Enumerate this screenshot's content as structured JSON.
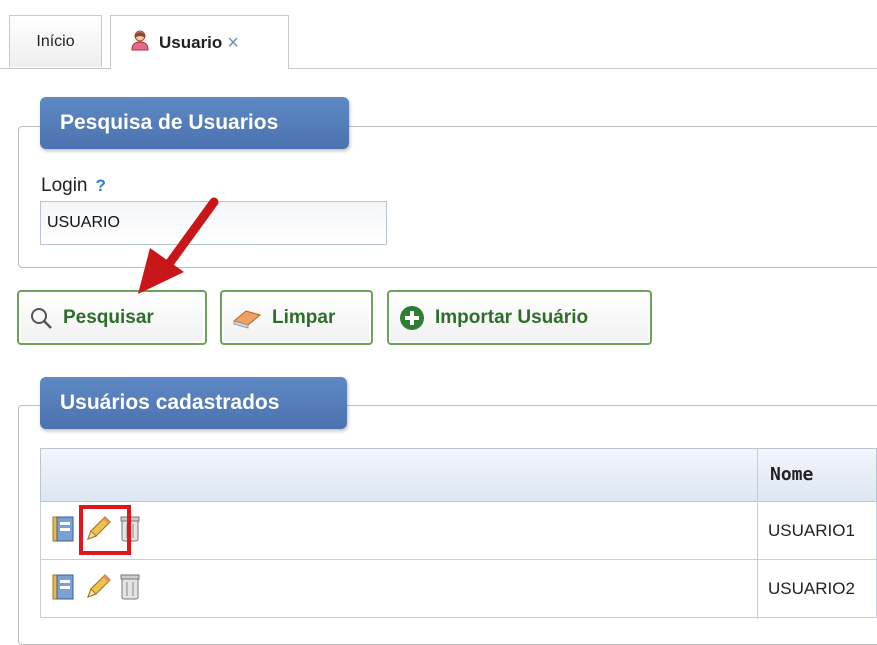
{
  "tabs": [
    {
      "label": "Início",
      "active": false
    },
    {
      "label": "Usuario",
      "active": true,
      "icon": "user-icon"
    }
  ],
  "search_panel": {
    "title": "Pesquisa de Usuarios",
    "login_label": "Login",
    "help_glyph": "?",
    "login_value": "USUARIO"
  },
  "buttons": {
    "pesquisar": "Pesquisar",
    "limpar": "Limpar",
    "importar": "Importar Usuário"
  },
  "list_panel": {
    "title": "Usuários cadastrados",
    "columns": [
      "",
      "Nome"
    ],
    "rows": [
      {
        "nome": "USUARIO1",
        "actions": [
          "details-icon",
          "edit-icon",
          "delete-icon"
        ],
        "highlighted_action": "edit-icon"
      },
      {
        "nome": "USUARIO2",
        "actions": [
          "details-icon",
          "edit-icon",
          "delete-icon"
        ]
      }
    ]
  },
  "colors": {
    "legend_blue": "#4a72b0",
    "button_green": "#6ea25b",
    "annotation_red": "#e0161b"
  }
}
